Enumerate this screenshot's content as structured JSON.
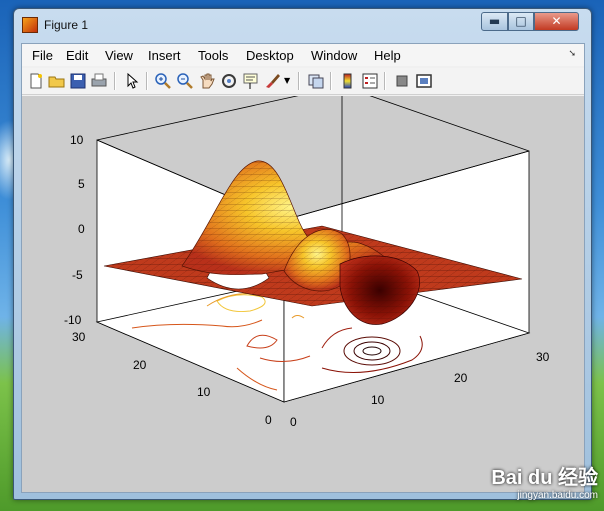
{
  "window": {
    "title": "Figure 1",
    "buttons": {
      "minimize": "▬",
      "maximize": "□",
      "close": "✕"
    }
  },
  "menu": [
    "File",
    "Edit",
    "View",
    "Insert",
    "Tools",
    "Desktop",
    "Window",
    "Help"
  ],
  "toolbar_icons": [
    "new-figure-icon",
    "open-file-icon",
    "save-icon",
    "print-icon",
    "edit-plot-arrow-icon",
    "zoom-in-icon",
    "zoom-out-icon",
    "pan-hand-icon",
    "rotate-3d-icon",
    "data-cursor-icon",
    "brush-icon",
    "link-plot-icon",
    "colorbar-icon",
    "legend-icon",
    "hide-plot-tools-icon",
    "show-plot-tools-icon"
  ],
  "chart_data": {
    "type": "surface",
    "zticks": [
      "10",
      "5",
      "0",
      "-5",
      "-10"
    ],
    "yticks": [
      "30",
      "20",
      "10",
      "0"
    ],
    "xticks": [
      "0",
      "10",
      "20",
      "30"
    ],
    "zlim": [
      -10,
      10
    ],
    "xlim": [
      0,
      30
    ],
    "ylim": [
      0,
      30
    ],
    "colormap": "hot",
    "contour_projection": true
  },
  "watermark": {
    "brand": "Bai du 经验",
    "url": "jingyan.baidu.com"
  }
}
